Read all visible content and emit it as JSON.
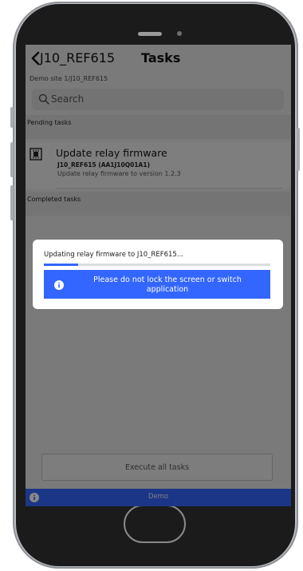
{
  "nav": {
    "back_label": "J10_REF615",
    "title": "Tasks"
  },
  "breadcrumb": "Demo site 1/J10_REF615",
  "search": {
    "placeholder": "Search"
  },
  "sections": {
    "pending": "Pending tasks",
    "completed": "Completed tasks"
  },
  "task": {
    "title": "Update relay firmware",
    "device": "J10_REF615 (AA1J10Q01A1)",
    "description": "Update relay firmware to version 1.2.3",
    "icon": "chip-icon"
  },
  "dialog": {
    "message": "Updating relay firmware to J10_REF615...",
    "progress_fraction": 0.15,
    "warning": "Please do not lock the screen or switch application"
  },
  "execute_button": "Execute all tasks",
  "footer": {
    "label": "Demo"
  },
  "colors": {
    "accent": "#3366ff",
    "overlay": "rgba(0,0,0,0.47)"
  }
}
